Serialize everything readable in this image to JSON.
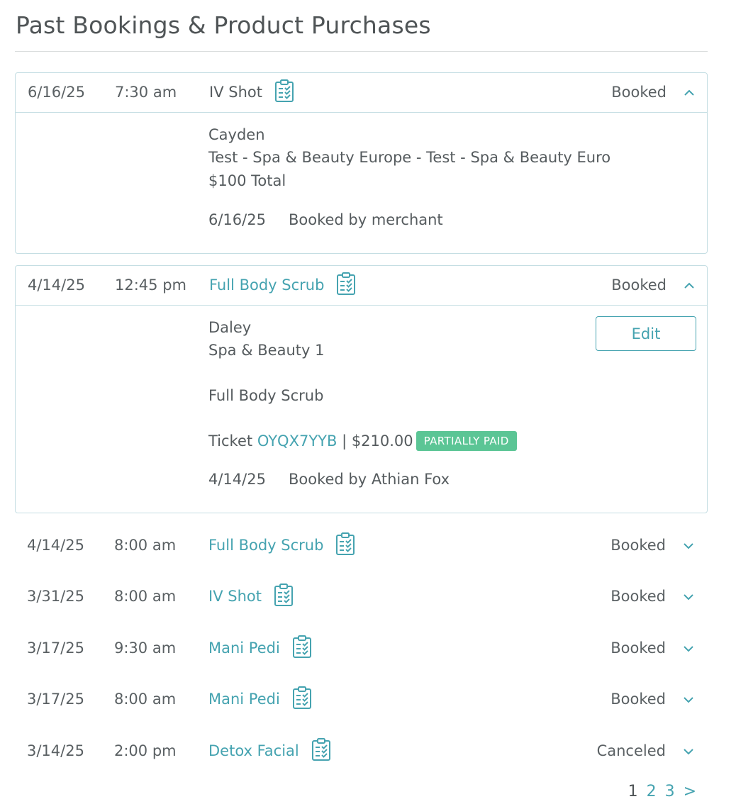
{
  "page": {
    "title": "Past Bookings & Product Purchases"
  },
  "colors": {
    "accent": "#45a3b0",
    "border": "#c5dee3",
    "badge": "#5bc595",
    "text": "#555b5e"
  },
  "expanded": [
    {
      "date": "6/16/25",
      "time": "7:30 am",
      "service": "IV Shot",
      "status": "Booked",
      "chevron": "chevron-up-icon",
      "client": "Cayden",
      "location": "Test - Spa & Beauty Europe - Test - Spa & Beauty Euro",
      "total": "$100 Total",
      "booked_date": "6/16/25",
      "booked_by": "Booked by merchant"
    },
    {
      "date": "4/14/25",
      "time": "12:45 pm",
      "service": "Full Body Scrub",
      "status": "Booked",
      "chevron": "chevron-up-icon",
      "client": "Daley",
      "location": "Spa & Beauty 1",
      "service_detail": "Full Body Scrub",
      "ticket_label": "Ticket",
      "ticket_id": "OYQX7YYB",
      "ticket_amount": "| $210.00",
      "payment_badge": "PARTIALLY PAID",
      "edit_label": "Edit",
      "booked_date": "4/14/25",
      "booked_by": "Booked by Athian Fox"
    }
  ],
  "rows": [
    {
      "date": "4/14/25",
      "time": "8:00 am",
      "service": "Full Body Scrub",
      "status": "Booked",
      "chevron": "chevron-down-icon"
    },
    {
      "date": "3/31/25",
      "time": "8:00 am",
      "service": "IV Shot",
      "status": "Booked",
      "chevron": "chevron-down-icon"
    },
    {
      "date": "3/17/25",
      "time": "9:30 am",
      "service": "Mani Pedi",
      "status": "Booked",
      "chevron": "chevron-down-icon"
    },
    {
      "date": "3/17/25",
      "time": "8:00 am",
      "service": "Mani Pedi",
      "status": "Booked",
      "chevron": "chevron-down-icon"
    },
    {
      "date": "3/14/25",
      "time": "2:00 pm",
      "service": "Detox Facial",
      "status": "Canceled",
      "chevron": "chevron-down-icon"
    }
  ],
  "pagination": {
    "current": "1",
    "pages": [
      "2",
      "3"
    ],
    "next": ">"
  }
}
